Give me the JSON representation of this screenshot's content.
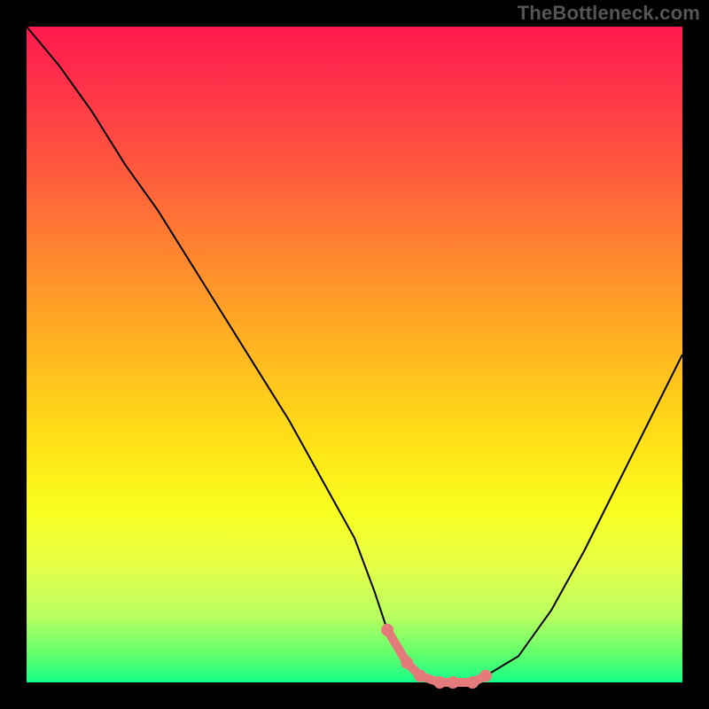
{
  "watermark": "TheBottleneck.com",
  "colors": {
    "background": "#000000",
    "curve": "#000000",
    "highlight": "#e47a7a",
    "gradient_top": "#ff1a4d",
    "gradient_bottom": "#15ff88"
  },
  "chart_data": {
    "type": "line",
    "title": "",
    "xlabel": "",
    "ylabel": "",
    "xlim": [
      0,
      100
    ],
    "ylim": [
      0,
      100
    ],
    "grid": false,
    "legend": null,
    "series": [
      {
        "name": "bottleneck-curve",
        "x": [
          0,
          5,
          10,
          15,
          20,
          25,
          30,
          35,
          40,
          45,
          50,
          53,
          55,
          58,
          60,
          63,
          65,
          68,
          70,
          75,
          80,
          85,
          90,
          95,
          100
        ],
        "y": [
          100,
          94,
          87,
          79,
          72,
          64,
          56,
          48,
          40,
          31,
          22,
          14,
          8,
          3,
          1,
          0,
          0,
          0,
          1,
          4,
          11,
          20,
          30,
          40,
          50
        ]
      }
    ],
    "annotations": [
      {
        "name": "optimal-zone",
        "type": "highlight-segment",
        "x_start": 55,
        "x_end": 70,
        "note": "flat bottom of the curve highlighted with pink markers"
      }
    ]
  }
}
